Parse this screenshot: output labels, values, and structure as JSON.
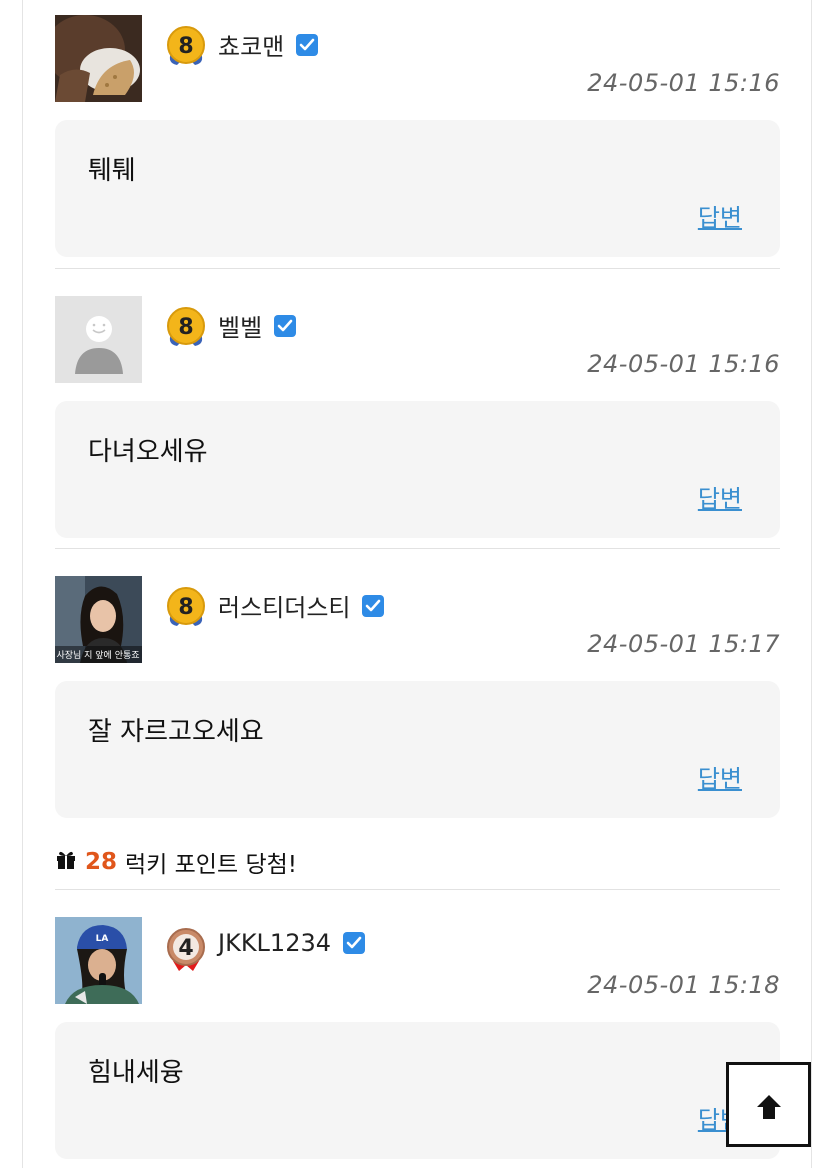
{
  "comments": [
    {
      "level": "8",
      "nickname": "쵸코맨",
      "time": "24-05-01 15:16",
      "text": "퉤퉤",
      "reply_label": "답변",
      "avatar": "food-photo"
    },
    {
      "level": "8",
      "nickname": "벨벨",
      "time": "24-05-01 15:16",
      "text": "다녀오세유",
      "reply_label": "답변",
      "avatar": "default-user"
    },
    {
      "level": "8",
      "nickname": "러스티더스티",
      "time": "24-05-01 15:17",
      "text": "잘 자르고오세요",
      "reply_label": "답변",
      "avatar": "woman-photo",
      "avatar_caption": "사장님 지 앞에 안통죠"
    },
    {
      "level": "4",
      "nickname": "JKKL1234",
      "time": "24-05-01 15:18",
      "text": "힘내세융",
      "reply_label": "답변",
      "avatar": "cap-woman-photo",
      "avatar_caption": "LA"
    }
  ],
  "lucky": {
    "icon": "gift-icon",
    "points": "28",
    "text": "럭키 포인트 당첨!"
  },
  "scroll_top": {
    "icon": "arrow-up-icon"
  },
  "colors": {
    "reply_link": "#3a8fd0",
    "verified": "#2e8be6",
    "lucky_points": "#e0561b",
    "bubble_bg": "#f5f5f5"
  }
}
